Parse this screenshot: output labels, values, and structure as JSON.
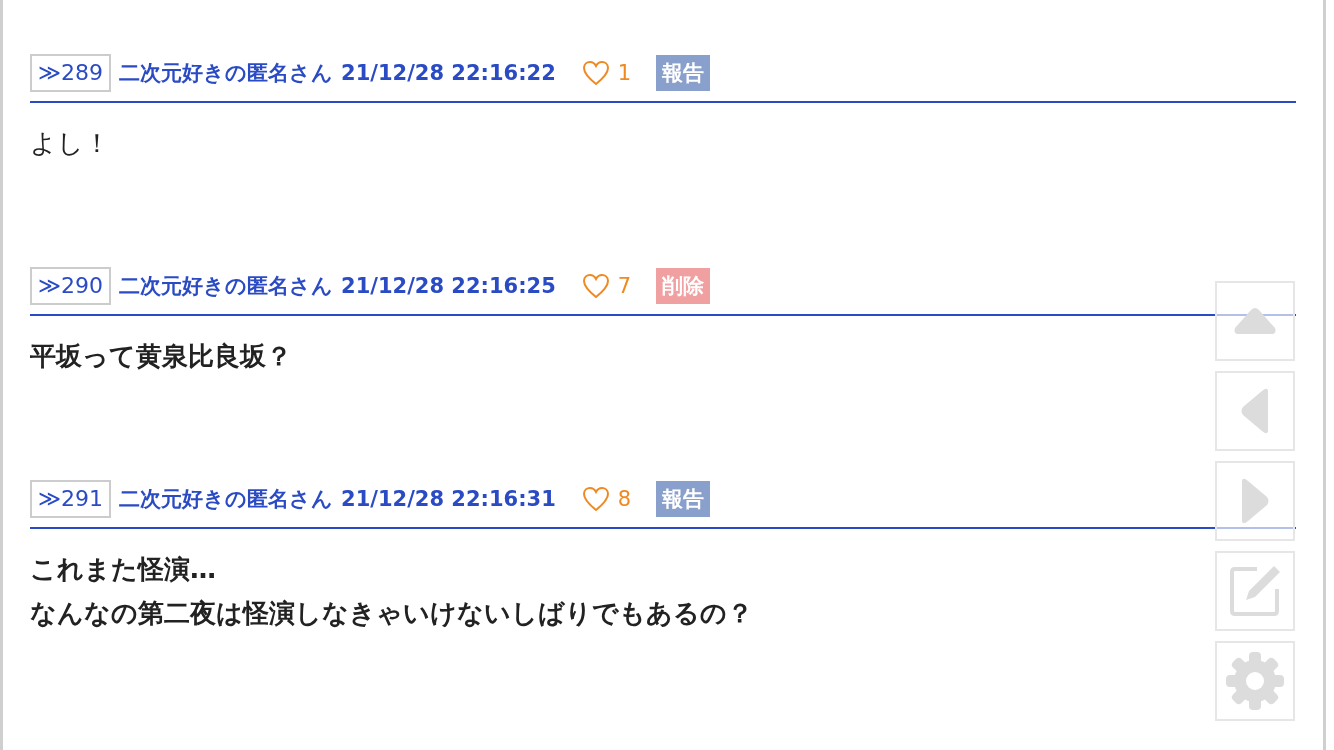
{
  "posts": [
    {
      "number": "≫289",
      "author": "二次元好きの匿名さん",
      "date": "21/12/28 22:16:22",
      "likes": "1",
      "action": {
        "kind": "report",
        "label": "報告"
      },
      "bold": false,
      "lines": [
        "よし！"
      ]
    },
    {
      "number": "≫290",
      "author": "二次元好きの匿名さん",
      "date": "21/12/28 22:16:25",
      "likes": "7",
      "action": {
        "kind": "delete",
        "label": "削除"
      },
      "bold": true,
      "lines": [
        "平坂って黄泉比良坂？"
      ]
    },
    {
      "number": "≫291",
      "author": "二次元好きの匿名さん",
      "date": "21/12/28 22:16:31",
      "likes": "8",
      "action": {
        "kind": "report",
        "label": "報告"
      },
      "bold": true,
      "lines": [
        "これまた怪演…",
        "なんなの第二夜は怪演しなきゃいけないしばりでもあるの？"
      ]
    }
  ],
  "float_buttons": [
    {
      "kind": "up"
    },
    {
      "kind": "left"
    },
    {
      "kind": "right"
    },
    {
      "kind": "edit"
    },
    {
      "kind": "settings"
    }
  ]
}
